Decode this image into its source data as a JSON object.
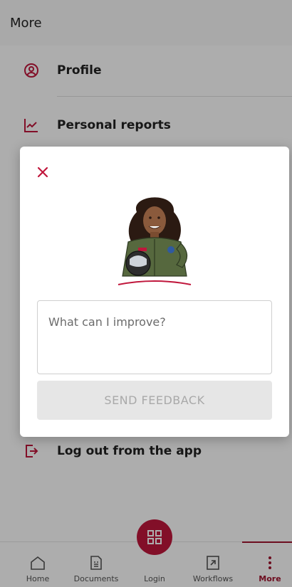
{
  "header": {
    "title": "More"
  },
  "menu": {
    "items": [
      {
        "label": "Profile",
        "icon": "profile-icon"
      },
      {
        "label": "Personal reports",
        "icon": "chart-icon"
      },
      {
        "label": "Log out from the app",
        "icon": "logout-icon"
      }
    ]
  },
  "dialog": {
    "close_icon": "close-icon",
    "feedback_placeholder": "What can I improve?",
    "send_label": "SEND FEEDBACK"
  },
  "bottom_nav": {
    "items": [
      {
        "label": "Home",
        "icon": "home-icon"
      },
      {
        "label": "Documents",
        "icon": "document-icon"
      },
      {
        "label": "Login",
        "icon": "qr-code-icon"
      },
      {
        "label": "Workflows",
        "icon": "workflow-icon"
      },
      {
        "label": "More",
        "icon": "more-vertical-icon"
      }
    ],
    "active": "More"
  },
  "colors": {
    "accent": "#c0173c",
    "active": "#a1142f",
    "scrim": "rgba(0,0,0,0.32)"
  }
}
